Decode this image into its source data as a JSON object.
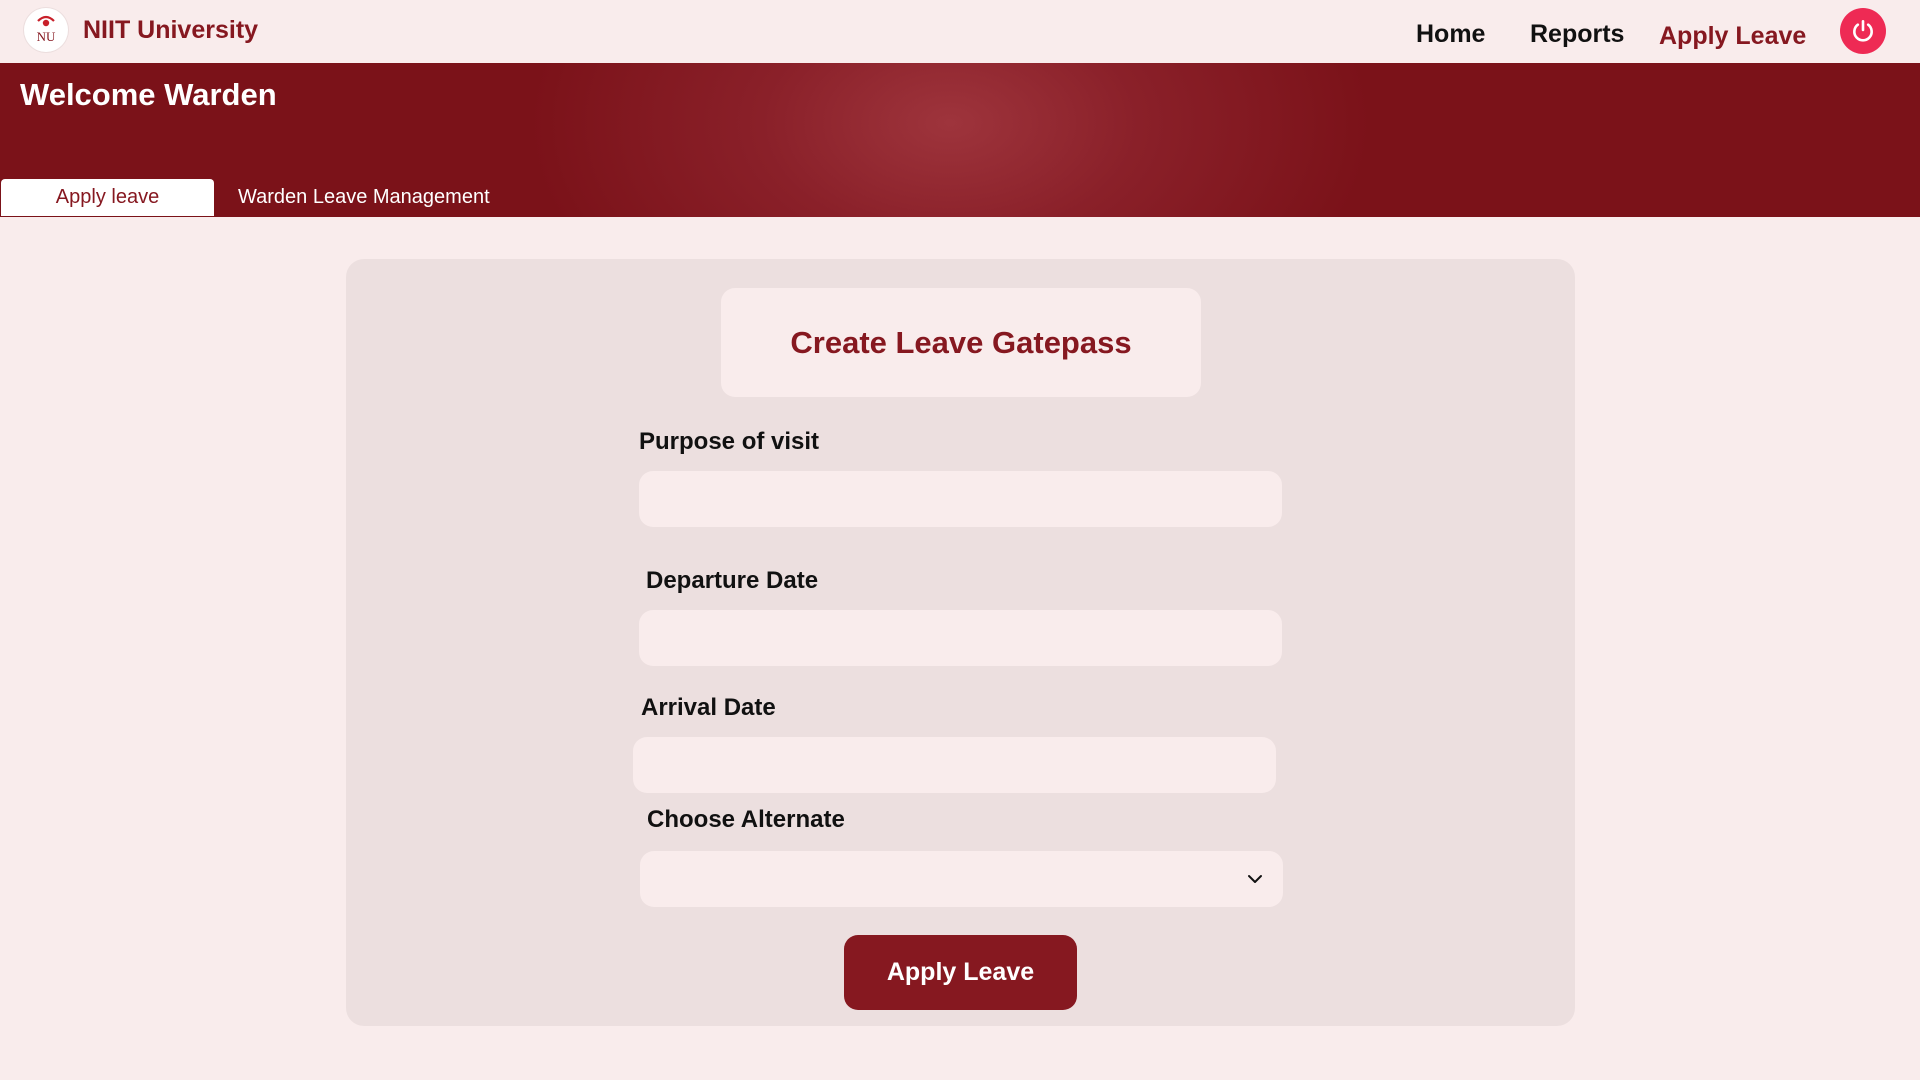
{
  "nav": {
    "brand": "NIIT University",
    "logo_text": "NU",
    "links": [
      "Home",
      "Reports",
      "Apply Leave"
    ],
    "active_link": "Apply Leave",
    "power_icon": "power-icon"
  },
  "banner": {
    "welcome": "Welcome Warden",
    "tabs": [
      {
        "label": "Apply leave",
        "active": true
      },
      {
        "label": "Warden Leave Management",
        "active": false
      }
    ]
  },
  "form": {
    "title": "Create Leave Gatepass",
    "fields": [
      {
        "label": "Purpose of visit",
        "value": "",
        "type": "text"
      },
      {
        "label": "Departure Date",
        "value": "",
        "type": "text"
      },
      {
        "label": "Arrival Date",
        "value": "",
        "type": "text"
      },
      {
        "label": "Choose Alternate",
        "value": "",
        "type": "select",
        "icon": "chevron-down-icon"
      }
    ],
    "submit_label": "Apply Leave"
  },
  "colors": {
    "brand": "#861820",
    "background": "#f9ecec",
    "card": "#ecdfdf",
    "power": "#ee2a54"
  }
}
